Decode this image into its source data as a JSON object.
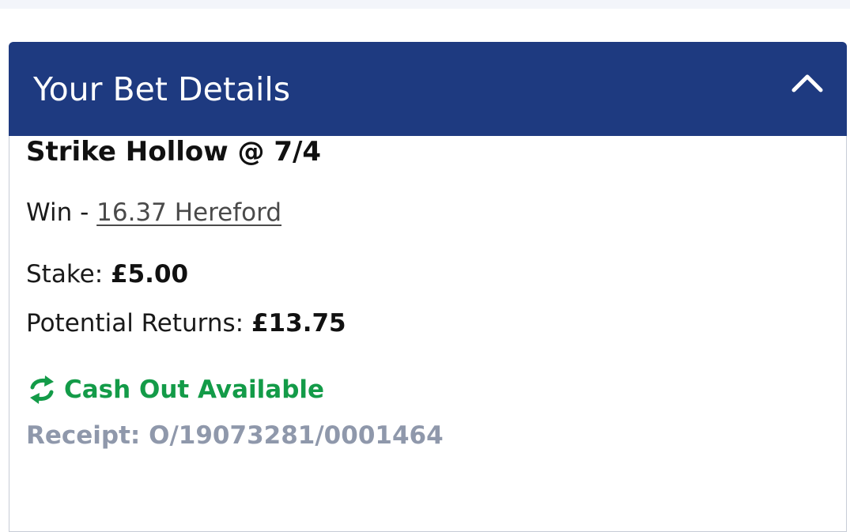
{
  "header": {
    "title": "Your Bet Details",
    "collapse_icon": "chevron-up-icon"
  },
  "bet": {
    "selection": "Strike Hollow @ 7/4",
    "market": "Win - ",
    "event": "16.37 Hereford",
    "stake_label": "Stake: ",
    "stake_value": "£5.00",
    "returns_label": "Potential Returns: ",
    "returns_value": "£13.75",
    "cashout_label": "Cash Out Available",
    "cashout_icon": "refresh-icon",
    "receipt": "Receipt: O/19073281/0001464"
  },
  "colors": {
    "header_bg": "#1e3a80",
    "cashout_green": "#139b48",
    "receipt_grey": "#8f98ab"
  }
}
